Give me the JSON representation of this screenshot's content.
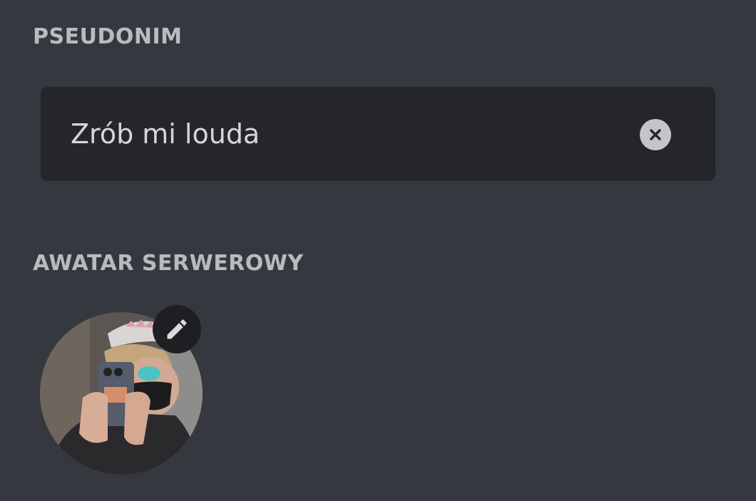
{
  "nickname": {
    "label": "PSEUDONIM",
    "value": "Zrób mi louda",
    "clear_icon": "close-circle-icon"
  },
  "server_avatar": {
    "label": "AWATAR SERWEROWY",
    "edit_icon": "pencil-icon"
  },
  "colors": {
    "background": "#36383f",
    "input_background": "#25262b",
    "label_text": "#b9bbc0",
    "input_text": "#d5d6d9"
  }
}
